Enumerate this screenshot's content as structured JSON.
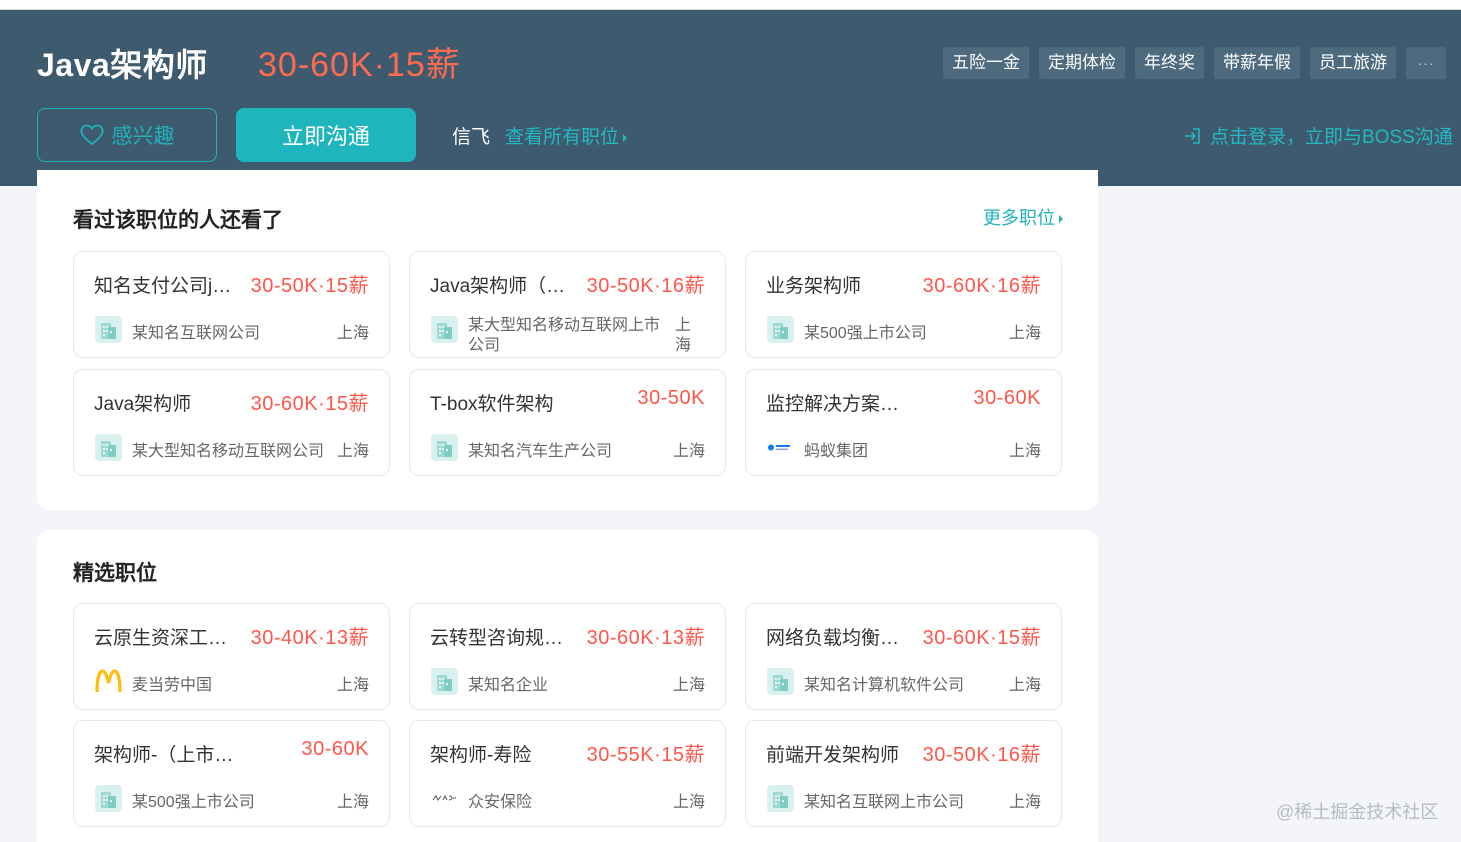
{
  "job": {
    "title": "Java架构师",
    "salary": "30-60K·15薪",
    "tags": [
      "五险一金",
      "定期体检",
      "年终奖",
      "带薪年假",
      "员工旅游"
    ],
    "tags_more": "···"
  },
  "actions": {
    "interest_label": "感兴趣",
    "chat_label": "立即沟通",
    "boss_name": "信飞",
    "all_jobs_label": "查看所有职位",
    "login_label": "点击登录，立即与BOSS沟通"
  },
  "related": {
    "title": "看过该职位的人还看了",
    "more_label": "更多职位",
    "cards": [
      {
        "name": "知名支付公司j…",
        "salary": "30-50K·15薪",
        "company": "某知名互联网公司",
        "city": "上海",
        "logo": "building-icon"
      },
      {
        "name": "Java架构师（…",
        "salary": "30-50K·16薪",
        "company": "某大型知名移动互联网上市公司",
        "city": "上海",
        "logo": "building-icon"
      },
      {
        "name": "业务架构师",
        "salary": "30-60K·16薪",
        "company": "某500强上市公司",
        "city": "上海",
        "logo": "building-icon"
      },
      {
        "name": "Java架构师",
        "salary": "30-60K·15薪",
        "company": "某大型知名移动互联网公司",
        "city": "上海",
        "logo": "building-icon"
      },
      {
        "name": "T-box软件架构",
        "salary": "30-50K",
        "company": "某知名汽车生产公司",
        "city": "上海",
        "logo": "building-icon"
      },
      {
        "name": "监控解决方案…",
        "salary": "30-60K",
        "company": "蚂蚁集团",
        "city": "上海",
        "logo": "ant-group-logo"
      }
    ]
  },
  "featured": {
    "title": "精选职位",
    "cards": [
      {
        "name": "云原生资深工…",
        "salary": "30-40K·13薪",
        "company": "麦当劳中国",
        "city": "上海",
        "logo": "mcdonalds-logo"
      },
      {
        "name": "云转型咨询规…",
        "salary": "30-60K·13薪",
        "company": "某知名企业",
        "city": "上海",
        "logo": "building-icon"
      },
      {
        "name": "网络负载均衡…",
        "salary": "30-60K·15薪",
        "company": "某知名计算机软件公司",
        "city": "上海",
        "logo": "building-icon"
      },
      {
        "name": "架构师-（上市…",
        "salary": "30-60K",
        "company": "某500强上市公司",
        "city": "上海",
        "logo": "building-icon"
      },
      {
        "name": "架构师-寿险",
        "salary": "30-55K·15薪",
        "company": "众安保险",
        "city": "上海",
        "logo": "zhongan-logo"
      },
      {
        "name": "前端开发架构师",
        "salary": "30-50K·16薪",
        "company": "某知名互联网上市公司",
        "city": "上海",
        "logo": "building-icon"
      }
    ]
  },
  "watermark": "@稀土掘金技术社区",
  "colors": {
    "header_bg": "#3e5a6e",
    "accent": "#1fb5bd",
    "salary": "#fe574a",
    "page_bg": "#f3f5f8"
  }
}
